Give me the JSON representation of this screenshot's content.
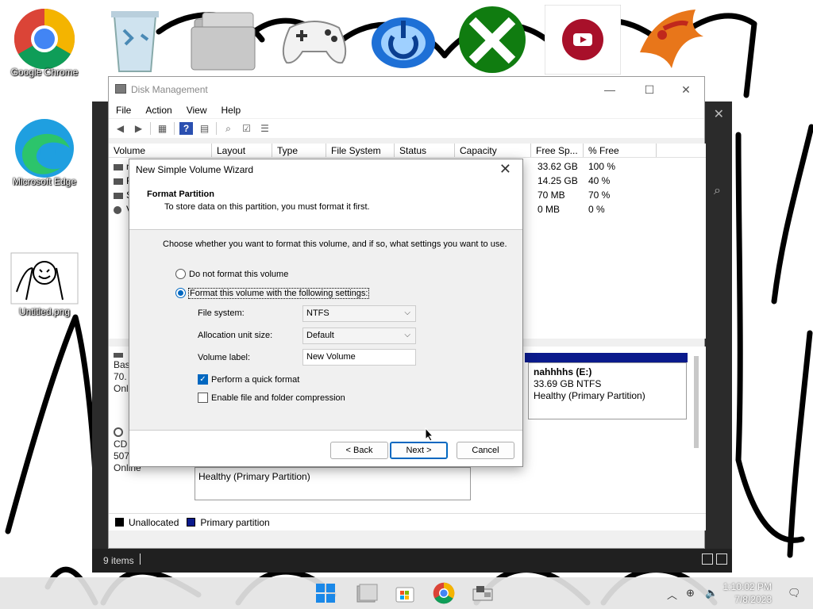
{
  "desktop": {
    "icons": [
      {
        "label": "Google Chrome"
      },
      {
        "label": "Microsoft Edge"
      },
      {
        "label": "Untitled.png"
      }
    ]
  },
  "bg_explorer": {
    "status_items": "9 items"
  },
  "disk_mgmt": {
    "title": "Disk Management",
    "menu": [
      "File",
      "Action",
      "View",
      "Help"
    ],
    "columns": [
      "Volume",
      "Layout",
      "Type",
      "File System",
      "Status",
      "Capacity",
      "Free Sp...",
      "% Free"
    ],
    "rows": [
      {
        "volume": "n",
        "free": "33.62 GB",
        "pct": "100 %"
      },
      {
        "volume": "F",
        "free": "14.25 GB",
        "pct": "40 %"
      },
      {
        "volume": "S",
        "free": "70 MB",
        "pct": "70 %"
      },
      {
        "volume": "V",
        "free": "0 MB",
        "pct": "0 %"
      }
    ],
    "disk0": {
      "name": "Bas",
      "size": "70.",
      "status": "Onl"
    },
    "cd": {
      "name": "CD",
      "size": "507",
      "status": "Online",
      "partition_status": "Healthy (Primary Partition)"
    },
    "partition": {
      "name": "nahhhhs  (E:)",
      "size": "33.69 GB NTFS",
      "status": "Healthy (Primary Partition)"
    },
    "legend": {
      "unallocated": "Unallocated",
      "primary": "Primary partition"
    },
    "colors": {
      "unallocated": "#000000",
      "primary": "#0a1a8c"
    }
  },
  "wizard": {
    "title": "New Simple Volume Wizard",
    "heading": "Format Partition",
    "subheading": "To store data on this partition, you must format it first.",
    "instruction": "Choose whether you want to format this volume, and if so, what settings you want to use.",
    "radio_no_format": "Do not format this volume",
    "radio_format": "Format this volume with the following settings:",
    "file_system_label": "File system:",
    "file_system_value": "NTFS",
    "alloc_label": "Allocation unit size:",
    "alloc_value": "Default",
    "volume_label_label": "Volume label:",
    "volume_label_value": "New Volume",
    "quick_format": "Perform a quick format",
    "compression": "Enable file and folder compression",
    "back": "< Back",
    "next": "Next >",
    "cancel": "Cancel"
  },
  "taskbar": {
    "time": "1:10:02 PM",
    "date": "7/8/2023"
  }
}
